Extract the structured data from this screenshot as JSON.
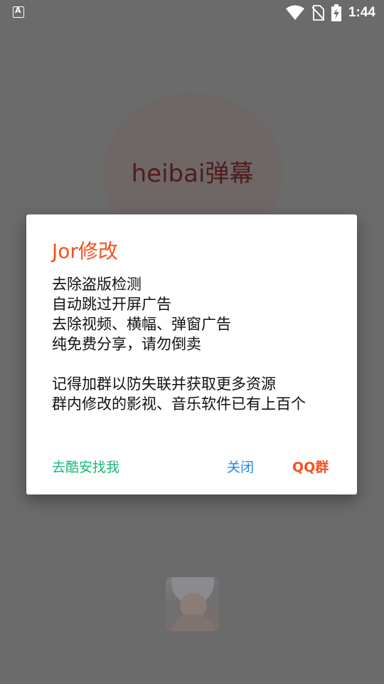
{
  "status_bar": {
    "time": "1:44",
    "icons": [
      "accessibility-a-icon",
      "wifi-icon",
      "no-sim-icon",
      "battery-charging-icon"
    ]
  },
  "background_app": {
    "logo_text": "heibai弹幕"
  },
  "dialog": {
    "title": "Jor修改",
    "message_lines": [
      "去除盗版检测",
      "自动跳过开屏广告",
      "去除视频、横幅、弹窗广告",
      "纯免费分享，请勿倒卖",
      "",
      "记得加群以防失联并获取更多资源",
      "群内修改的影视、音乐软件已有上百个"
    ],
    "buttons": {
      "coolapk": "去酷安找我",
      "close": "关闭",
      "qq": "QQ群"
    },
    "colors": {
      "title": "#f4511e",
      "coolapk": "#17b978",
      "close": "#1e88e5",
      "qq": "#f4511e"
    }
  }
}
